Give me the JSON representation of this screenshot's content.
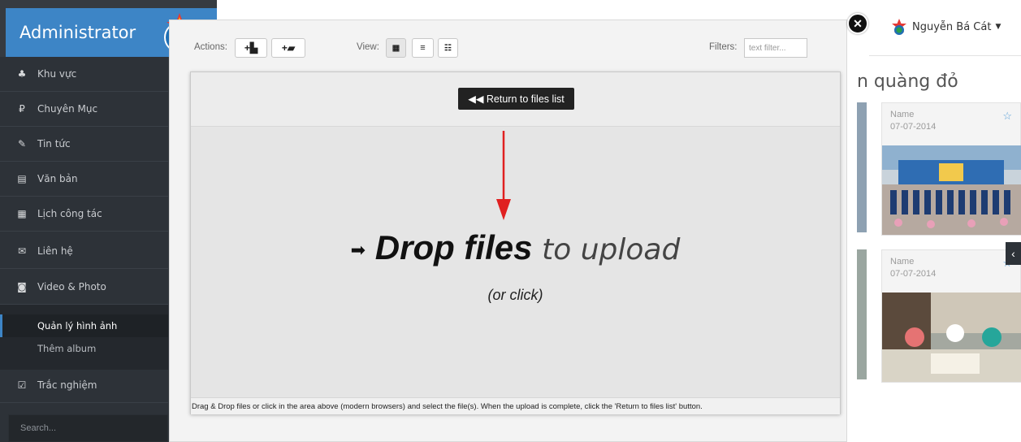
{
  "sidebar": {
    "brand": "Administrator",
    "items": [
      {
        "label": "Khu vực",
        "icon": "sitemap-icon",
        "glyph": "♣"
      },
      {
        "label": "Chuyên Mục",
        "icon": "ruble-icon",
        "glyph": "₽"
      },
      {
        "label": "Tin tức",
        "icon": "pencil-icon",
        "glyph": "✎"
      },
      {
        "label": "Văn bản",
        "icon": "file-icon",
        "glyph": "▤"
      },
      {
        "label": "Lịch công tác",
        "icon": "calendar-icon",
        "glyph": "▦"
      },
      {
        "label": "Liên hệ",
        "icon": "envelope-icon",
        "glyph": "✉"
      },
      {
        "label": "Video & Photo",
        "icon": "camera-icon",
        "glyph": "◙"
      },
      {
        "label": "Trắc nghiệm",
        "icon": "checkbox-icon",
        "glyph": "☑"
      }
    ],
    "sub_items": [
      {
        "label": "Quản lý hình ảnh",
        "active": true
      },
      {
        "label": "Thêm album",
        "active": false
      }
    ],
    "search_placeholder": "Search..."
  },
  "header": {
    "user_name": "Nguyễn Bá Cát",
    "page_title_partial": "n quàng đỏ"
  },
  "cards": [
    {
      "name": "Name",
      "date": "07-07-2014"
    },
    {
      "name": "Name",
      "date": "07-07-2014"
    }
  ],
  "modal": {
    "actions_label": "Actions:",
    "view_label": "View:",
    "filters_label": "Filters:",
    "filter_placeholder": "text filter...",
    "return_button": "◀◀ Return to files list",
    "drop_bold": "Drop files",
    "drop_light": "to upload",
    "drop_sub": "(or click)",
    "note": "Drag & Drop files or click in the area above (modern browsers) and select the file(s). When the upload is complete, click the 'Return to files list' button."
  },
  "colors": {
    "brand_blue": "#3d85c6",
    "sidebar_dark": "#2d3238",
    "annotation_arrow": "#e02020"
  }
}
